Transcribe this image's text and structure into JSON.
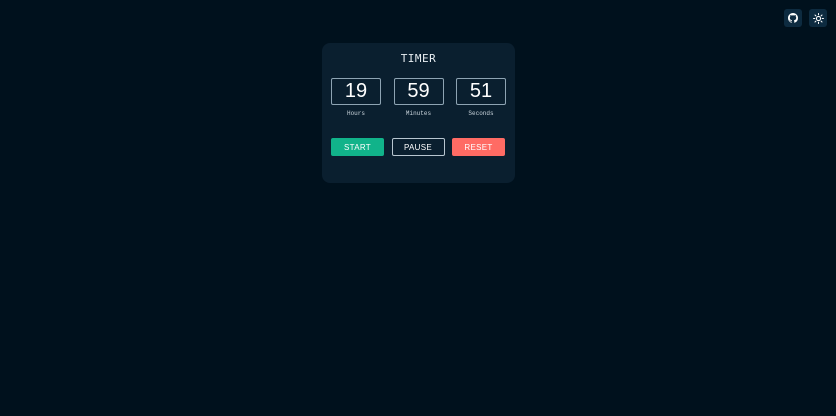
{
  "header": {
    "icons": [
      "github-icon",
      "sun-icon"
    ]
  },
  "timer": {
    "title": "TIMER",
    "hours": {
      "value": "19",
      "label": "Hours"
    },
    "minutes": {
      "value": "59",
      "label": "Minutes"
    },
    "seconds": {
      "value": "51",
      "label": "Seconds"
    }
  },
  "controls": {
    "start_label": "START",
    "pause_label": "PAUSE",
    "reset_label": "RESET"
  },
  "colors": {
    "background": "#00111d",
    "card": "#0a1f2f",
    "start": "#11b38a",
    "reset": "#ff6b64"
  }
}
